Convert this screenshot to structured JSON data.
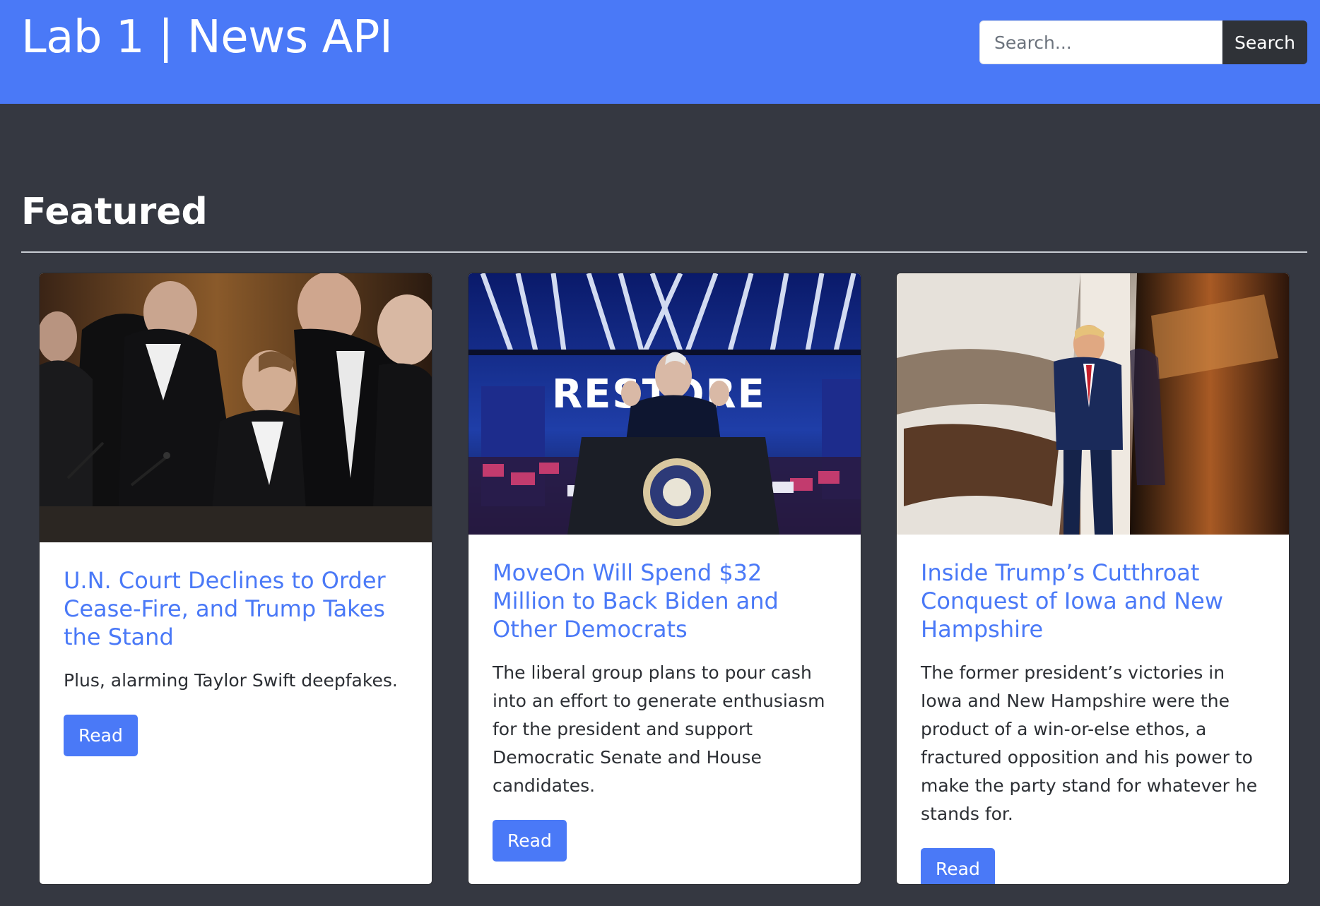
{
  "header": {
    "brand": "Lab 1 | News API",
    "search_placeholder": "Search...",
    "search_button": "Search"
  },
  "main": {
    "section_title": "Featured",
    "articles": [
      {
        "title": "U.N. Court Declines to Order Cease-Fire, and Trump Takes the Stand",
        "description": "Plus, alarming Taylor Swift deepfakes.",
        "button": "Read"
      },
      {
        "title": "MoveOn Will Spend $32 Million to Back Biden and Other Democrats",
        "description": "The liberal group plans to pour cash into an effort to generate enthusiasm for the president and support Democratic Senate and House candidates.",
        "button": "Read"
      },
      {
        "title": "Inside Trump’s Cutthroat Conquest of Iowa and New Hampshire",
        "description": "The former president’s victories in Iowa and New Hampshire were the product of a win-or-else ethos, a fractured opposition and his power to make the party stand for whatever he stands for.",
        "button": "Read"
      }
    ]
  },
  "colors": {
    "primary": "#4a79f7",
    "page_background": "#353841",
    "search_button": "#2f3237"
  }
}
